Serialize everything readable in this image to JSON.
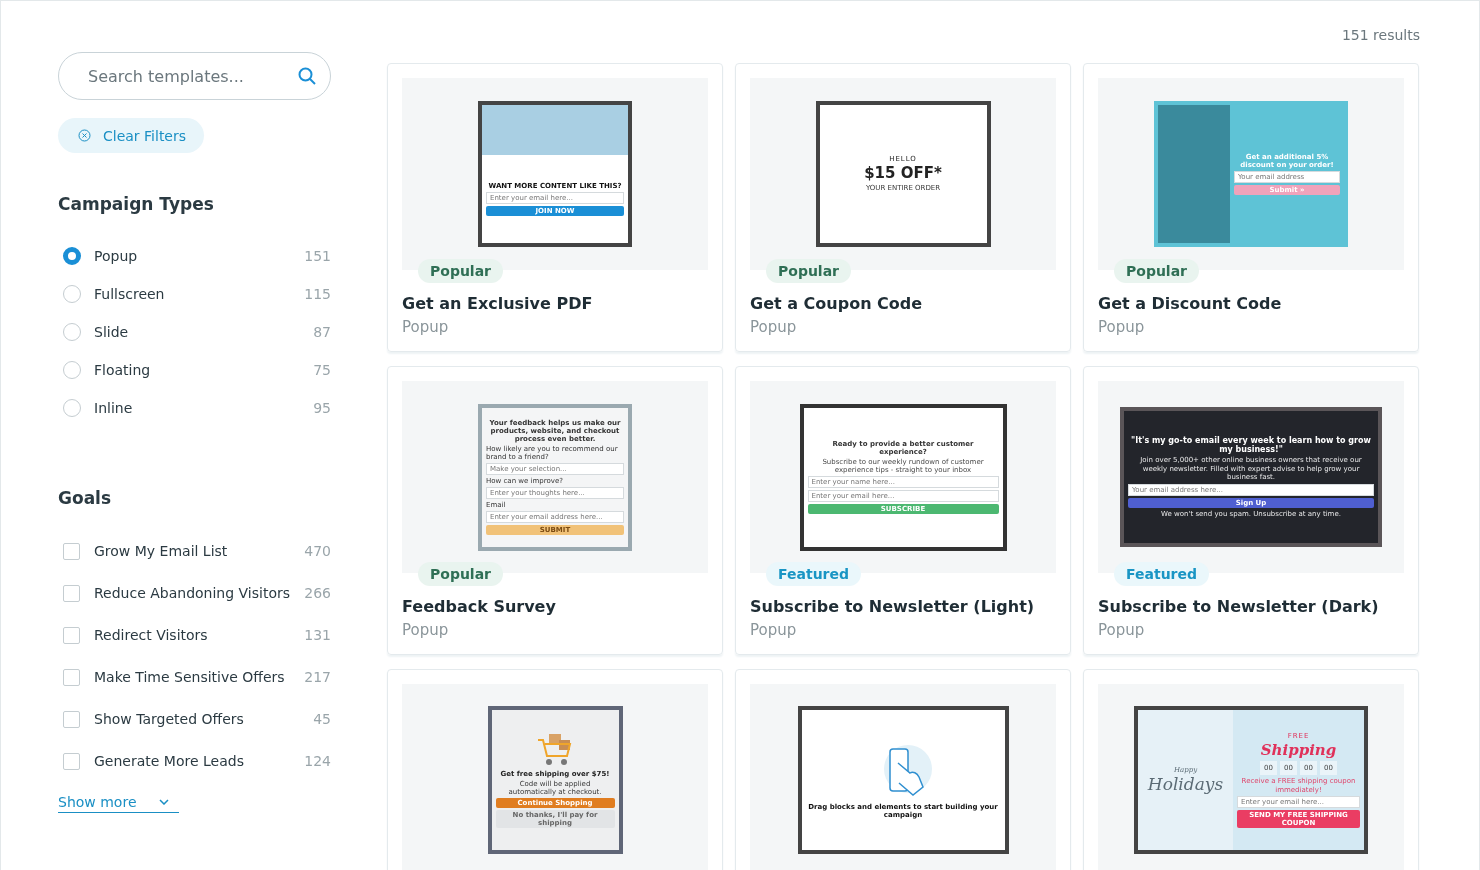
{
  "results": "151 results",
  "search": {
    "placeholder": "Search templates..."
  },
  "clear_filters": "Clear Filters",
  "campaign_types": {
    "title": "Campaign Types",
    "items": [
      {
        "label": "Popup",
        "count": "151",
        "selected": true
      },
      {
        "label": "Fullscreen",
        "count": "115",
        "selected": false
      },
      {
        "label": "Slide",
        "count": "87",
        "selected": false
      },
      {
        "label": "Floating",
        "count": "75",
        "selected": false
      },
      {
        "label": "Inline",
        "count": "95",
        "selected": false
      }
    ]
  },
  "goals": {
    "title": "Goals",
    "items": [
      {
        "label": "Grow My Email List",
        "count": "470",
        "checked": false
      },
      {
        "label": "Reduce Abandoning Visitors",
        "count": "266",
        "checked": false
      },
      {
        "label": "Redirect Visitors",
        "count": "131",
        "checked": false
      },
      {
        "label": "Make Time Sensitive Offers",
        "count": "217",
        "checked": false
      },
      {
        "label": "Show Targeted Offers",
        "count": "45",
        "checked": false
      },
      {
        "label": "Generate More Leads",
        "count": "124",
        "checked": false
      }
    ],
    "show_more": "Show more"
  },
  "cards": [
    {
      "badge": {
        "label": "Popular",
        "kind": "popular"
      },
      "title": "Get an Exclusive PDF",
      "type": "Popup",
      "preview": {
        "kind": "pdf",
        "heading": "WANT MORE CONTENT LIKE THIS?",
        "fields": [
          "Enter your email here..."
        ],
        "buttons": [
          "JOIN NOW"
        ]
      }
    },
    {
      "badge": {
        "label": "Popular",
        "kind": "popular"
      },
      "title": "Get a Coupon Code",
      "type": "Popup",
      "preview": {
        "kind": "coupon",
        "kicker": "HELLO",
        "heading": "$15 OFF*",
        "lines": [
          "YOUR ENTIRE ORDER"
        ]
      }
    },
    {
      "badge": {
        "label": "Popular",
        "kind": "popular"
      },
      "title": "Get a Discount Code",
      "type": "Popup",
      "preview": {
        "kind": "discount",
        "heading": "Get an additional **5% discount** on your order!",
        "fields": [
          "Your email address"
        ],
        "buttons": [
          "Submit »"
        ]
      }
    },
    {
      "badge": {
        "label": "Popular",
        "kind": "popular"
      },
      "title": "Feedback Survey",
      "type": "Popup",
      "preview": {
        "kind": "feedback",
        "heading": "Your feedback helps us make our products, website, and checkout process even better.",
        "fields": [
          "How likely are you to recommend our brand to a friend?",
          "Make your selection...",
          "How can we improve?",
          "Enter your thoughts here...",
          "Email",
          "Enter your email address here..."
        ],
        "buttons": [
          "SUBMIT"
        ]
      }
    },
    {
      "badge": {
        "label": "Featured",
        "kind": "featured"
      },
      "title": "Subscribe to Newsletter (Light)",
      "type": "Popup",
      "preview": {
        "kind": "newsletter-light",
        "heading": "Ready to provide a better customer experience?",
        "lines": [
          "Subscribe to our weekly rundown of customer experience tips - straight to your inbox"
        ],
        "fields": [
          "Enter your name here...",
          "Enter your email here..."
        ],
        "buttons": [
          "SUBSCRIBE"
        ]
      }
    },
    {
      "badge": {
        "label": "Featured",
        "kind": "featured"
      },
      "title": "Subscribe to Newsletter (Dark)",
      "type": "Popup",
      "preview": {
        "kind": "newsletter-dark",
        "heading": "\"It's my go-to email every week to learn how to grow my business!\"",
        "lines": [
          "Join over 5,000+ other online business owners that receive our weekly newsletter. Filled with expert advise to help grow your business fast."
        ],
        "fields": [
          "Your email address here..."
        ],
        "buttons": [
          "Sign Up"
        ],
        "note": "We won't send you spam. Unsubscribe at any time."
      }
    },
    {
      "preview": {
        "kind": "shipping",
        "heading": "Get free shipping over $75!",
        "lines": [
          "Code will be applied automatically at checkout."
        ],
        "buttons": [
          "Continue Shopping",
          "No thanks, I'll pay for shipping"
        ]
      }
    },
    {
      "preview": {
        "kind": "blank",
        "heading": "Drag blocks and elements to start building your campaign"
      }
    },
    {
      "preview": {
        "kind": "holiday",
        "art_texts": [
          "Happy",
          "Holidays"
        ],
        "kicker": "FREE",
        "heading": "Shipping",
        "countdown": [
          "00",
          "00",
          "00",
          "00"
        ],
        "lines": [
          "Receive a FREE shipping coupon immediately!"
        ],
        "fields": [
          "Enter your email here..."
        ],
        "buttons": [
          "SEND MY FREE SHIPPING COUPON"
        ]
      }
    }
  ]
}
